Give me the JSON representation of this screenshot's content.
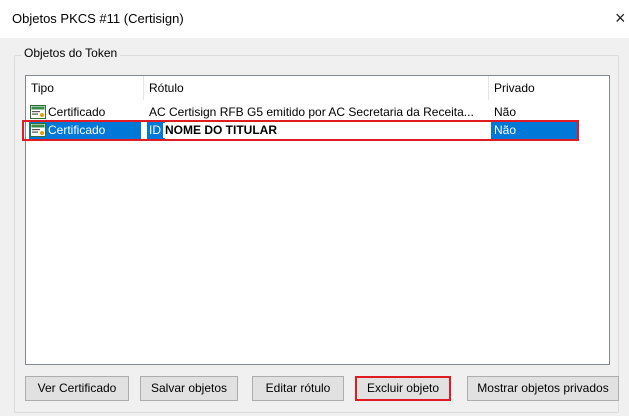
{
  "window": {
    "title": "Objetos PKCS #11 (Certisign)",
    "close_glyph": "×"
  },
  "group": {
    "label": "Objetos do Token"
  },
  "list": {
    "columns": [
      "Tipo",
      "Rótulo",
      "Privado"
    ],
    "rows": [
      {
        "icon": "certificate-icon",
        "tipo": "Certificado",
        "rotulo": "AC Certisign RFB G5 emitido por AC Secretaria da Receita...",
        "privado": "Não",
        "selected": false
      },
      {
        "icon": "certificate-icon",
        "tipo": "Certificado",
        "rotulo_prefix": "ID",
        "rotulo_name": "NOME DO TITULAR",
        "privado": "Não",
        "selected": true
      }
    ]
  },
  "buttons": {
    "ver": "Ver Certificado",
    "salvar": "Salvar objetos",
    "editar": "Editar rótulo",
    "excluir": "Excluir objeto",
    "mostrar": "Mostrar objetos privados"
  },
  "colors": {
    "selection": "#0078d7",
    "highlight_outline": "#e01b24"
  }
}
